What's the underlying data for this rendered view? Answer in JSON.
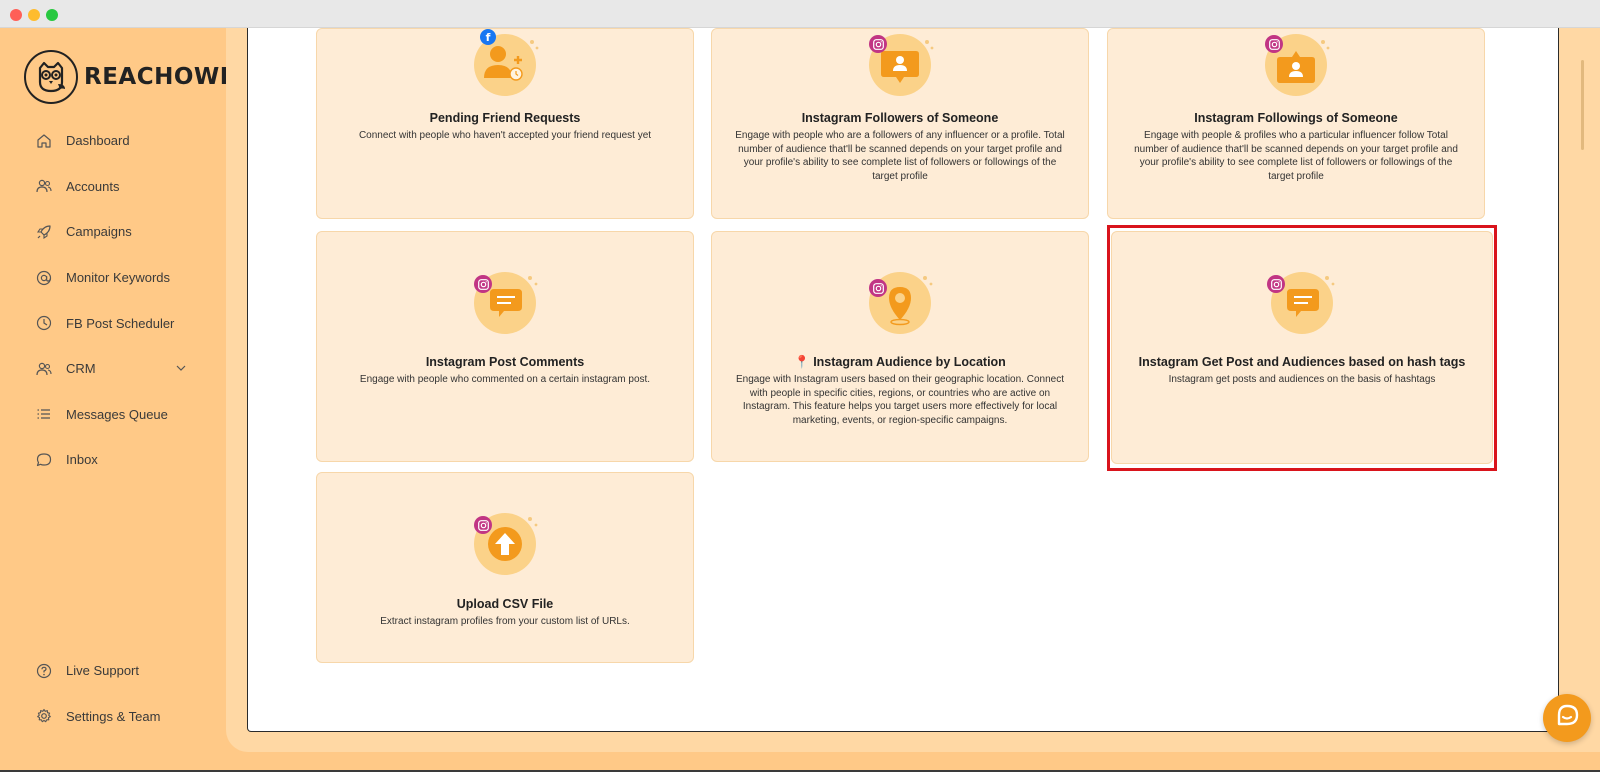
{
  "brand": {
    "name": "REACHOWL"
  },
  "sidebar": {
    "items": [
      {
        "label": "Dashboard",
        "icon": "home-icon"
      },
      {
        "label": "Accounts",
        "icon": "users-icon"
      },
      {
        "label": "Campaigns",
        "icon": "rocket-icon"
      },
      {
        "label": "Monitor Keywords",
        "icon": "at-icon"
      },
      {
        "label": "FB Post Scheduler",
        "icon": "clock-icon"
      },
      {
        "label": "CRM",
        "icon": "users-icon"
      },
      {
        "label": "Messages Queue",
        "icon": "list-icon"
      },
      {
        "label": "Inbox",
        "icon": "chat-icon"
      }
    ],
    "bottom": [
      {
        "label": "Live Support",
        "icon": "help-icon"
      },
      {
        "label": "Settings & Team",
        "icon": "gear-icon"
      }
    ]
  },
  "cards": [
    {
      "title": "Pending Friend Requests",
      "desc": "Connect with people who haven't accepted your friend request yet",
      "badge": "facebook",
      "icon": "friend-request-icon"
    },
    {
      "title": "Instagram Followers of Someone",
      "desc": "Engage with people who are a followers of any influencer or a profile. Total number of audience that'll be scanned depends on your target profile and your profile's ability to see complete list of followers or followings of the target profile",
      "badge": "instagram",
      "icon": "followers-icon"
    },
    {
      "title": "Instagram Followings of Someone",
      "desc": "Engage with people & profiles who a particular influencer follow Total number of audience that'll be scanned depends on your target profile and your profile's ability to see complete list of followers or followings of the target profile",
      "badge": "instagram",
      "icon": "followings-icon"
    },
    {
      "title": "Instagram Post Comments",
      "desc": "Engage with people who commented on a certain instagram post.",
      "badge": "instagram",
      "icon": "comment-icon"
    },
    {
      "title": "📍 Instagram Audience by Location",
      "desc": "Engage with Instagram users based on their geographic location. Connect with people in specific cities, regions, or countries who are active on Instagram. This feature helps you target users more effectively for local marketing, events, or region-specific campaigns.",
      "badge": "instagram",
      "icon": "location-icon"
    },
    {
      "title": "Instagram Get Post and Audiences based on hash tags",
      "desc": "Instagram get posts and audiences on the basis of hashtags",
      "badge": "instagram",
      "icon": "hashtag-comment-icon"
    },
    {
      "title": "Upload CSV File",
      "desc": "Extract instagram profiles from your custom list of URLs.",
      "badge": "instagram",
      "icon": "upload-icon"
    }
  ],
  "colors": {
    "sidebar_bg": "#ffc987",
    "card_bg": "#feecd6",
    "accent": "#f39a1d",
    "highlight": "#d9141c",
    "instagram": "#c13584",
    "facebook": "#1877f2"
  }
}
